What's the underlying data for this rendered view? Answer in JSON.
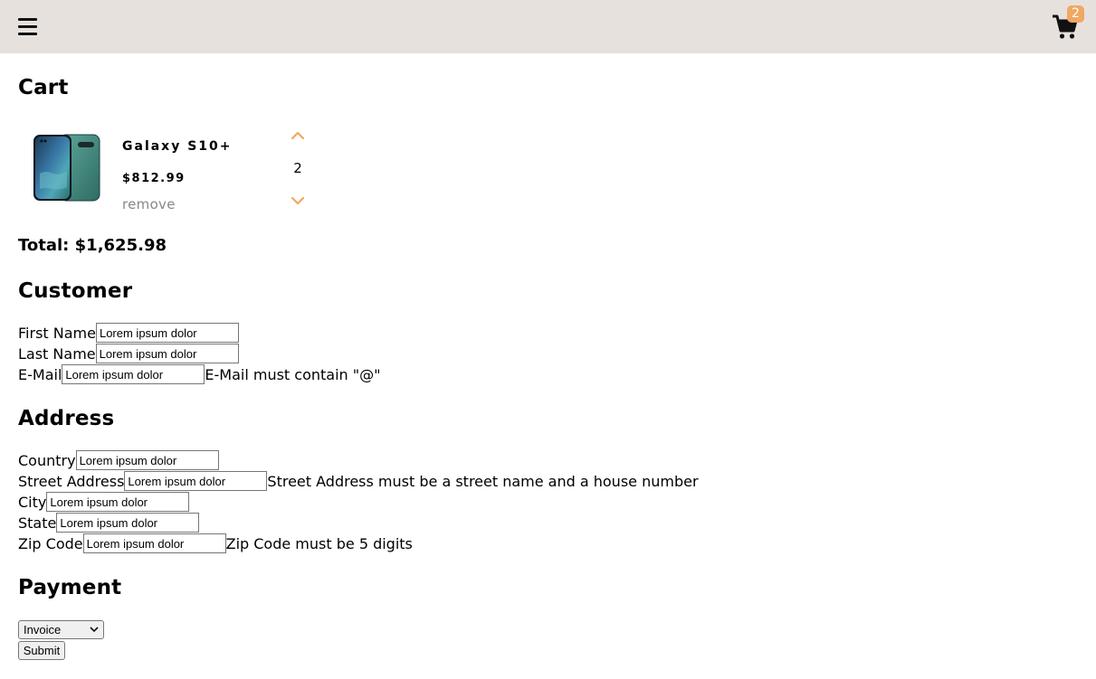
{
  "header": {
    "cart_count": "2",
    "menu_icon": "hamburger-menu-icon",
    "cart_icon": "shopping-cart-icon",
    "accent_color": "#f0a862",
    "bar_color": "#e6e1dd"
  },
  "cart": {
    "title": "Cart",
    "items": [
      {
        "name": "Galaxy S10+",
        "price": "$812.99",
        "quantity": "2",
        "remove_label": "remove"
      }
    ],
    "total": "Total: $1,625.98"
  },
  "customer": {
    "title": "Customer",
    "first_name": {
      "label": "First Name",
      "value": "Lorem ipsum dolor"
    },
    "last_name": {
      "label": "Last Name",
      "value": "Lorem ipsum dolor"
    },
    "email": {
      "label": "E-Mail",
      "value": "Lorem ipsum dolor",
      "error": "E-Mail must contain \"@\""
    }
  },
  "address": {
    "title": "Address",
    "country": {
      "label": "Country",
      "value": "Lorem ipsum dolor"
    },
    "street": {
      "label": "Street Address",
      "value": "Lorem ipsum dolor",
      "error": "Street Address must be a street name and a house number"
    },
    "city": {
      "label": "City",
      "value": "Lorem ipsum dolor"
    },
    "state": {
      "label": "State",
      "value": "Lorem ipsum dolor"
    },
    "zip": {
      "label": "Zip Code",
      "value": "Lorem ipsum dolor",
      "error": "Zip Code must be 5 digits"
    }
  },
  "payment": {
    "title": "Payment",
    "method_selected": "Invoice",
    "submit_label": "Submit"
  }
}
